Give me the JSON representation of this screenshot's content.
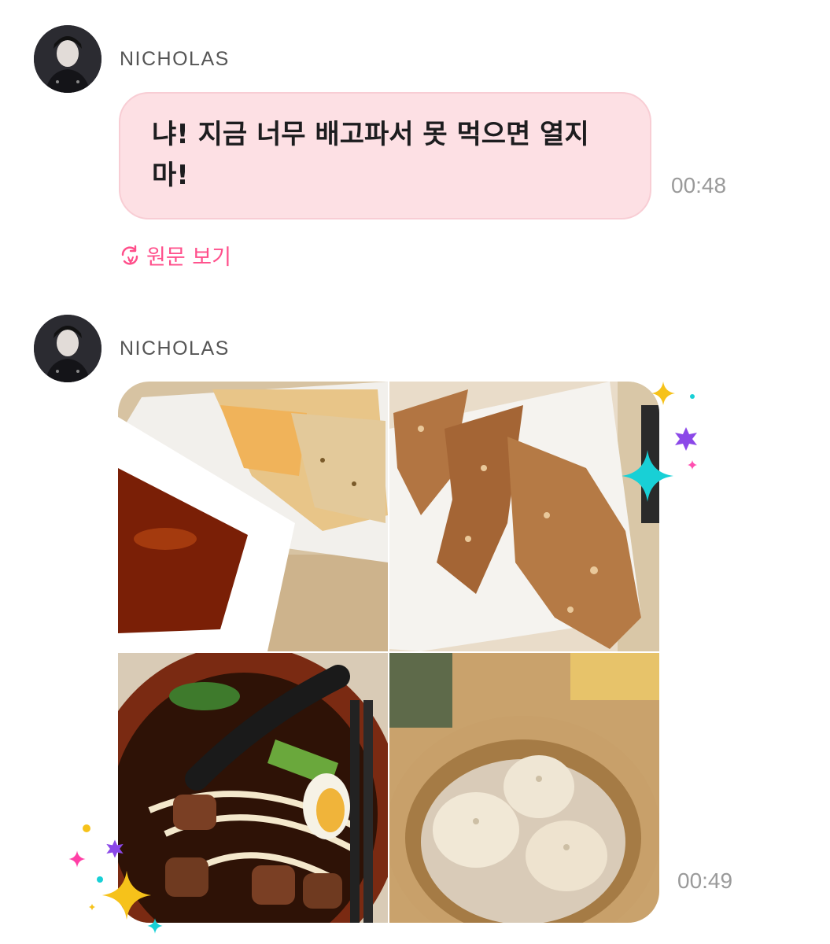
{
  "messages": [
    {
      "sender": "NICHOLAS",
      "text": "냐! 지금 너무 배고파서 못 먹으면 열지 마!",
      "time": "00:48",
      "view_original_label": "원문 보기"
    },
    {
      "sender": "NICHOLAS",
      "time": "00:49",
      "photos": [
        "scallion-pancake-photo",
        "fried-pork-cutlet-photo",
        "beef-noodle-soup-photo",
        "soup-dumplings-photo"
      ]
    }
  ],
  "colors": {
    "bubble": "#fde0e4",
    "accent": "#ff4f8b",
    "time": "#9a9a9a",
    "sender": "#555555"
  },
  "icons": {
    "view_original": "refresh-translate-icon",
    "sparkles": [
      "gold-star",
      "cyan-star",
      "purple-burst",
      "pink-star"
    ]
  }
}
